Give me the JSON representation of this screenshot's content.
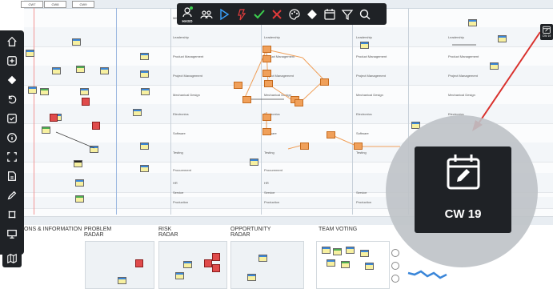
{
  "toolbar": {
    "haso_label": "HASO",
    "icons": [
      "haso-avatar-icon",
      "team-icon",
      "play-icon",
      "thumb-icon",
      "checkmark-icon",
      "close-icon",
      "palette-icon",
      "diamond-milestone-icon",
      "calendar-icon",
      "filter-icon",
      "search-icon"
    ],
    "colors": {
      "background": "#1f2226",
      "play": "#3aa3ff",
      "thumb": "#e23d3d",
      "check": "#3ccf4e",
      "close": "#e03a3a"
    }
  },
  "sidebar": {
    "icons": [
      "home-icon",
      "add-icon",
      "diamond-icon",
      "undo-icon",
      "checkbox-icon",
      "info-icon",
      "fullscreen-icon",
      "document-icon",
      "pencil-icon",
      "frame-icon",
      "presentation-icon"
    ],
    "bottom_icon": "map-icon"
  },
  "board": {
    "cw_labels": [
      "CW7",
      "CW8",
      "CW9"
    ],
    "lanes": [
      "Milestones",
      "Leadership",
      "Product Management",
      "Project Management",
      "Mechanical Design",
      "Electronics",
      "Software",
      "Testing",
      "Procurement",
      "HR",
      "Service",
      "Production"
    ]
  },
  "sections": {
    "info": "IONS & INFORMATION",
    "problem_radar": [
      "PROBLEM",
      "RADAR"
    ],
    "risk_radar": [
      "RISK",
      "RADAR"
    ],
    "opportunity_radar": [
      "OPPORTUNITY",
      "RADAR"
    ],
    "team_voting": "TEAM VOTING"
  },
  "callout": {
    "label": "CW 19",
    "icon": "calendar-edit-icon",
    "corner_label": "CW 19",
    "arrow_color": "#d9312d"
  }
}
